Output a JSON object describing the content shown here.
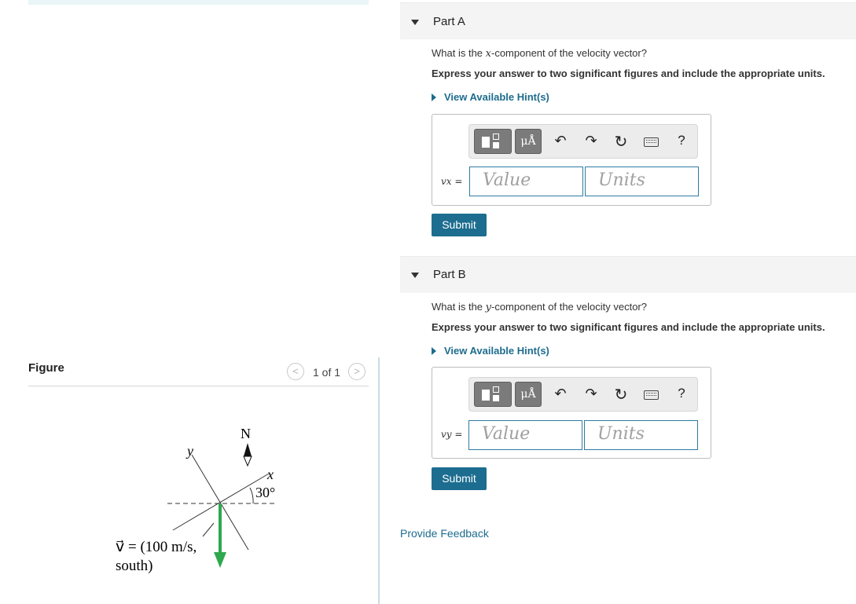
{
  "figure": {
    "title": "Figure",
    "pager": {
      "prev_icon": "<",
      "next_icon": ">",
      "count": "1 of 1"
    },
    "diagram": {
      "north_label": "N",
      "x_axis_label": "x",
      "y_axis_label": "y",
      "angle_label": "30°",
      "vector_line1": "v⃗ = (100 m/s,",
      "vector_line2": "south)",
      "vector_color": "#2fa84f"
    }
  },
  "parts": [
    {
      "title": "Part A",
      "question_prefix": "What is the ",
      "question_var": "x",
      "question_suffix": "-component of the velocity vector?",
      "instruction": "Express your answer to two significant figures and include the appropriate units.",
      "hint": "View Available Hint(s)",
      "toolbar": {
        "templates_icon": "templates-icon",
        "units_label": "μÅ",
        "undo": "↶",
        "redo": "↷",
        "reset": "↻",
        "keyboard": "keyboard-icon",
        "help": "?"
      },
      "variable_label": "vx =",
      "value_placeholder": "Value",
      "units_placeholder": "Units",
      "submit_label": "Submit"
    },
    {
      "title": "Part B",
      "question_prefix": "What is the ",
      "question_var": "y",
      "question_suffix": "-component of the velocity vector?",
      "instruction": "Express your answer to two significant figures and include the appropriate units.",
      "hint": "View Available Hint(s)",
      "toolbar": {
        "templates_icon": "templates-icon",
        "units_label": "μÅ",
        "undo": "↶",
        "redo": "↷",
        "reset": "↻",
        "keyboard": "keyboard-icon",
        "help": "?"
      },
      "variable_label": "vy =",
      "value_placeholder": "Value",
      "units_placeholder": "Units",
      "submit_label": "Submit"
    }
  ],
  "feedback_link": "Provide Feedback",
  "colors": {
    "accent": "#1d6c8e",
    "button": "#1c6d8f",
    "field_border": "#2f7ba3"
  }
}
